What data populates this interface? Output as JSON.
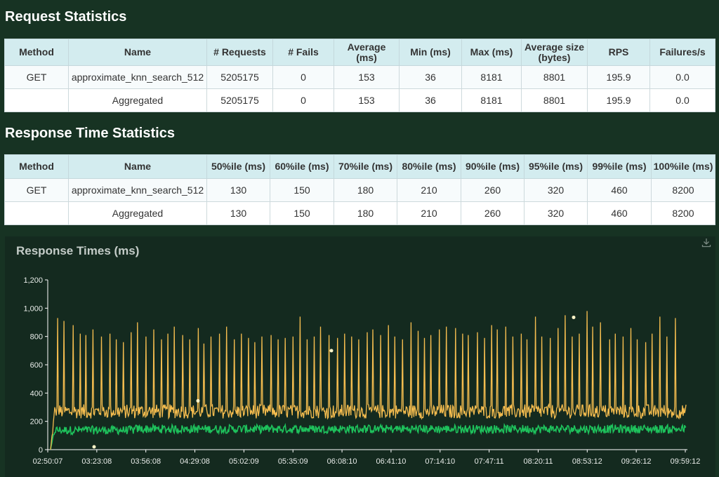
{
  "request_stats": {
    "title": "Request Statistics",
    "headers": [
      "Method",
      "Name",
      "# Requests",
      "# Fails",
      "Average (ms)",
      "Min (ms)",
      "Max (ms)",
      "Average size (bytes)",
      "RPS",
      "Failures/s"
    ],
    "rows": [
      [
        "GET",
        "approximate_knn_search_512",
        "5205175",
        "0",
        "153",
        "36",
        "8181",
        "8801",
        "195.9",
        "0.0"
      ],
      [
        "",
        "Aggregated",
        "5205175",
        "0",
        "153",
        "36",
        "8181",
        "8801",
        "195.9",
        "0.0"
      ]
    ]
  },
  "response_time_stats": {
    "title": "Response Time Statistics",
    "headers": [
      "Method",
      "Name",
      "50%ile (ms)",
      "60%ile (ms)",
      "70%ile (ms)",
      "80%ile (ms)",
      "90%ile (ms)",
      "95%ile (ms)",
      "99%ile (ms)",
      "100%ile (ms)"
    ],
    "rows": [
      [
        "GET",
        "approximate_knn_search_512",
        "130",
        "150",
        "180",
        "210",
        "260",
        "320",
        "460",
        "8200"
      ],
      [
        "",
        "Aggregated",
        "130",
        "150",
        "180",
        "210",
        "260",
        "320",
        "460",
        "8200"
      ]
    ]
  },
  "chart": {
    "title": "Response Times (ms)",
    "download_icon": "download-icon"
  },
  "chart_data": {
    "type": "line",
    "title": "Response Times (ms)",
    "xlabel": "",
    "ylabel": "",
    "ylim": [
      0,
      1200
    ],
    "y_ticks": [
      "0",
      "200",
      "400",
      "600",
      "800",
      "1,000",
      "1,200"
    ],
    "x_ticks": [
      "02:50:07",
      "03:23:08",
      "03:56:08",
      "04:29:08",
      "05:02:09",
      "05:35:09",
      "06:08:10",
      "06:41:10",
      "07:14:10",
      "07:47:11",
      "08:20:11",
      "08:53:12",
      "09:26:12",
      "09:59:12"
    ],
    "grid": false,
    "colors": {
      "upper": "#f5bd4f",
      "lower": "#1ec25c",
      "axis": "#ffffff"
    },
    "series": [
      {
        "baseline": 270,
        "noise": 50,
        "spikes": [
          930,
          910,
          880,
          820,
          810,
          850,
          800,
          820,
          780,
          760,
          830,
          900,
          800,
          850,
          780,
          820,
          870,
          810,
          780,
          860,
          750,
          800,
          820,
          870,
          780,
          820,
          790,
          760,
          800,
          810,
          780,
          790,
          800,
          940,
          780,
          800,
          870,
          810,
          790,
          820,
          800,
          780,
          830,
          850,
          810,
          880,
          800,
          780,
          900,
          840,
          790,
          810,
          850,
          870,
          860,
          820,
          810,
          830,
          790,
          880,
          850,
          870,
          800,
          820,
          780,
          940,
          800,
          790,
          860,
          950,
          800,
          820,
          980,
          870,
          900,
          780,
          820,
          800,
          860,
          780,
          760,
          820,
          940,
          800,
          930
        ]
      },
      {
        "baseline": 150,
        "noise": 30,
        "spikes": []
      }
    ]
  }
}
